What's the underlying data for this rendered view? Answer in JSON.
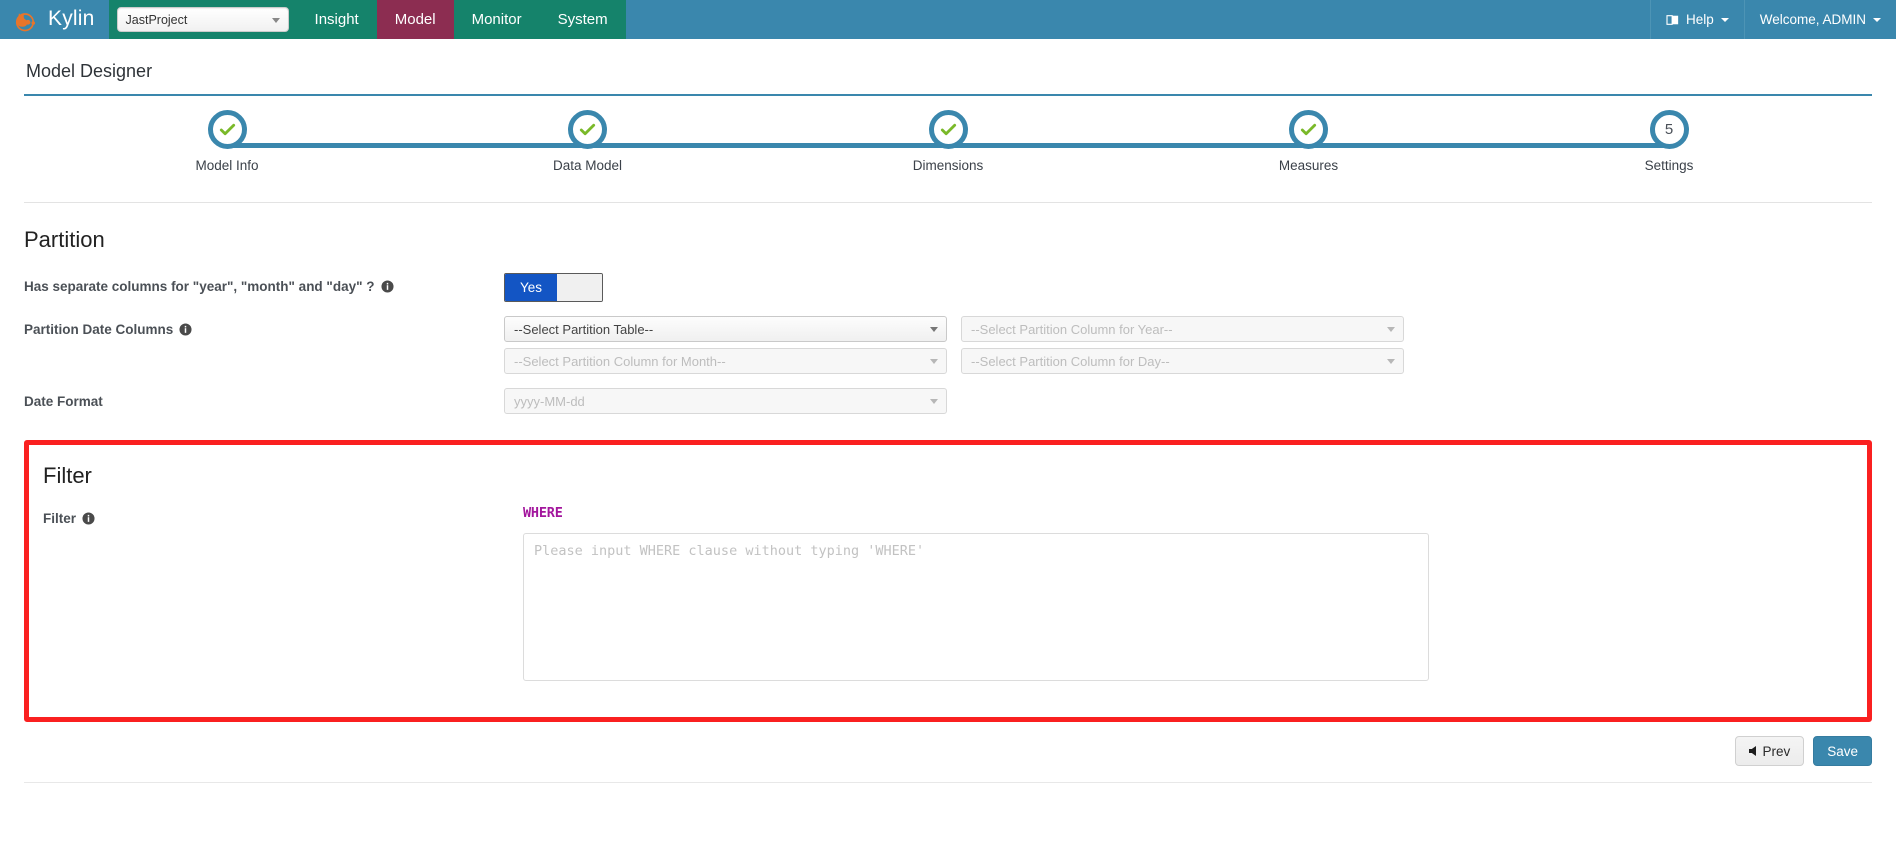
{
  "header": {
    "brand": "Kylin",
    "brand_logo_icon": "kylin-logo-icon",
    "project_selector": {
      "value": "JastProject",
      "caret_icon": "caret-down-icon"
    },
    "nav": [
      {
        "label": "Insight",
        "active": false
      },
      {
        "label": "Model",
        "active": true
      },
      {
        "label": "Monitor",
        "active": false
      },
      {
        "label": "System",
        "active": false
      }
    ],
    "help": {
      "label": "Help",
      "icon": "book-icon",
      "caret_icon": "caret-down-icon"
    },
    "user": {
      "label": "Welcome, ADMIN",
      "caret_icon": "caret-down-icon"
    },
    "colors": {
      "navbar_blue": "#3a87ad",
      "nav_green": "#15836b",
      "nav_active_maroon": "#8c2d51"
    }
  },
  "page": {
    "title": "Model Designer"
  },
  "wizard": {
    "steps": [
      {
        "label": "Model Info",
        "state": "complete",
        "marker": "check-icon"
      },
      {
        "label": "Data Model",
        "state": "complete",
        "marker": "check-icon"
      },
      {
        "label": "Dimensions",
        "state": "complete",
        "marker": "check-icon"
      },
      {
        "label": "Measures",
        "state": "complete",
        "marker": "check-icon"
      },
      {
        "label": "Settings",
        "state": "current",
        "marker": "5"
      }
    ],
    "colors": {
      "track": "#3a87ad",
      "check": "#7ab929"
    }
  },
  "partition": {
    "title": "Partition",
    "separate_columns": {
      "label": "Has separate columns for \"year\", \"month\" and \"day\" ?",
      "info_icon": "info-icon",
      "toggle_on_label": "Yes",
      "toggle_value": "Yes"
    },
    "date_columns": {
      "label": "Partition Date Columns",
      "info_icon": "info-icon",
      "selects": [
        {
          "value": "--Select Partition Table--",
          "enabled": true,
          "caret_icon": "caret-down-icon"
        },
        {
          "value": "--Select Partition Column for Year--",
          "enabled": false,
          "caret_icon": "caret-down-icon"
        },
        {
          "value": "--Select Partition Column for Month--",
          "enabled": false,
          "caret_icon": "caret-down-icon"
        },
        {
          "value": "--Select Partition Column for Day--",
          "enabled": false,
          "caret_icon": "caret-down-icon"
        }
      ]
    },
    "date_format": {
      "label": "Date Format",
      "value": "yyyy-MM-dd",
      "caret_icon": "caret-down-icon"
    }
  },
  "filter": {
    "title": "Filter",
    "label": "Filter",
    "info_icon": "info-icon",
    "where_label": "WHERE",
    "where_placeholder": "Please input WHERE clause without typing 'WHERE'",
    "where_value": "",
    "highlight_color": "#fa2020"
  },
  "footer": {
    "prev_label": "Prev",
    "prev_icon": "arrow-left-icon",
    "save_label": "Save"
  }
}
